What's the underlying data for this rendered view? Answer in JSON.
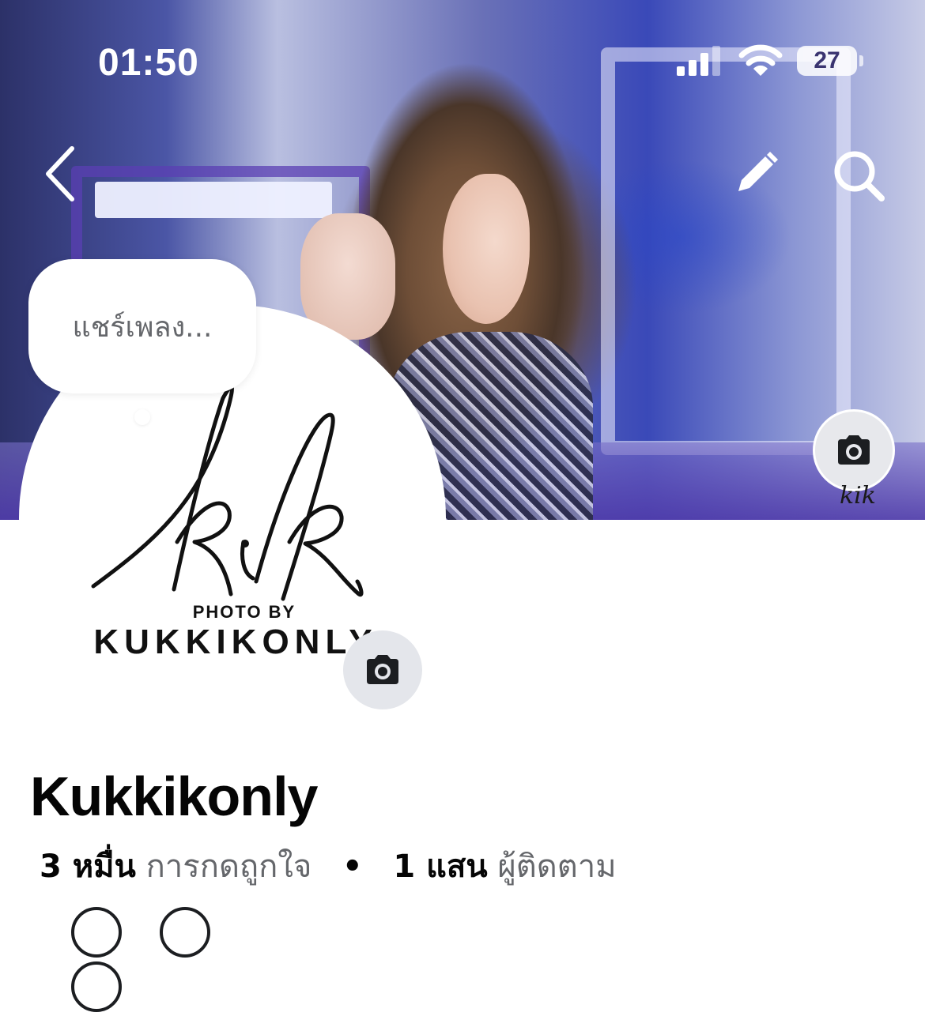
{
  "status_bar": {
    "time": "01:50",
    "battery_level": "27",
    "icons": [
      "signal-icon",
      "wifi-icon",
      "battery-icon"
    ]
  },
  "header": {
    "back_icon": "chevron-left-icon",
    "edit_icon": "pencil-icon",
    "search_icon": "search-icon"
  },
  "cover": {
    "camera_icon": "camera-icon",
    "watermark": "kik"
  },
  "note": {
    "placeholder": "แชร์เพลง..."
  },
  "profile_picture": {
    "logo_script": "kik",
    "caption_line1": "PHOTO BY",
    "caption_line2": "KUKKIKONLY",
    "camera_icon": "camera-icon"
  },
  "page": {
    "name": "Kukkikonly",
    "likes_count": "3 หมื่น",
    "likes_label": "การกดถูกใจ",
    "separator": "•",
    "followers_count": "1 แสน",
    "followers_label": "ผู้ติดตาม"
  },
  "colors": {
    "text_primary": "#050505",
    "text_secondary": "#65676b",
    "button_bg": "#e4e6eb"
  }
}
